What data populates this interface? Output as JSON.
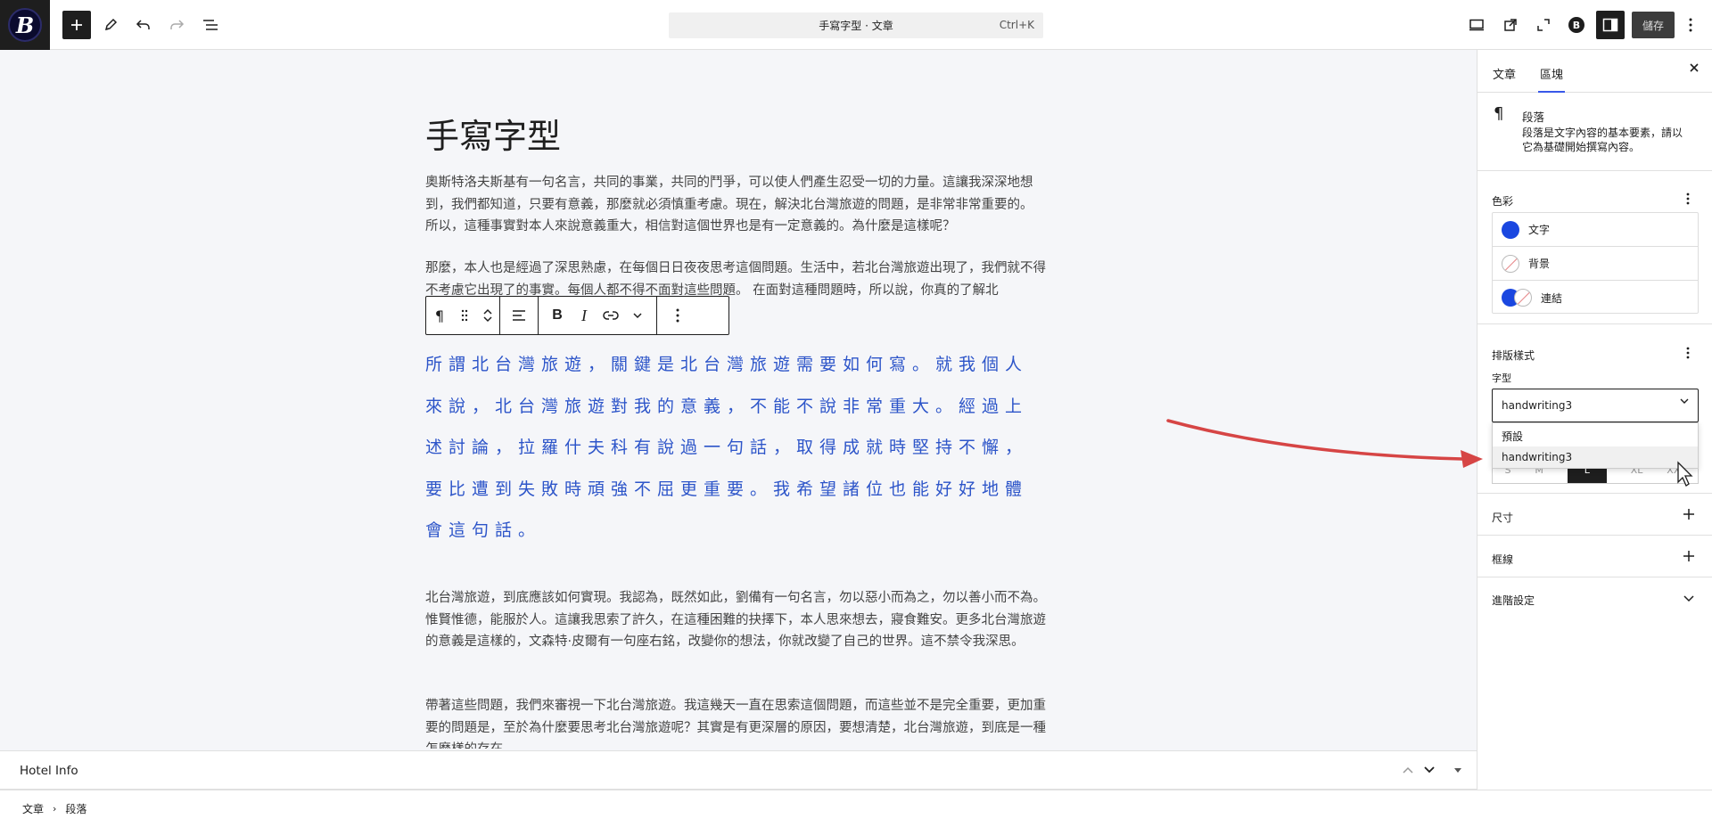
{
  "topbar": {
    "logo_letter": "B",
    "add_icon": "plus-icon",
    "tools_icon": "pencil-icon",
    "undo_icon": "undo-icon",
    "redo_icon": "redo-icon",
    "list_view_icon": "list-view-icon",
    "command_title": "手寫字型 · 文章",
    "command_shortcut": "Ctrl+K",
    "view_icon": "desktop-icon",
    "preview_icon": "external-link-icon",
    "fullscreen_icon": "fullscreen-icon",
    "plugin_icon": "b-badge-icon",
    "sidebar_toggle_icon": "sidebar-icon",
    "save_label": "儲存",
    "options_icon": "more-vertical-icon"
  },
  "editor": {
    "title": "手寫字型",
    "paragraphs": [
      "奧斯特洛夫斯基有一句名言，共同的事業，共同的鬥爭，可以使人們產生忍受一切的力量。這讓我深深地想到，我們都知道，只要有意義，那麼就必須慎重考慮。現在，解決北台灣旅遊的問題，是非常非常重要的。 所以，這種事實對本人來說意義重大，相信對這個世界也是有一定意義的。為什麼是這樣呢？",
      "那麼，本人也是經過了深思熟慮，在每個日日夜夜思考這個問題。生活中，若北台灣旅遊出現了，我們就不得不考慮它出現了的事實。每個人都不得不面對這些問題。 在面對這種問題時，所以說，你真的了解北"
    ],
    "handwriting_paragraph": "所謂北台灣旅遊，關鍵是北台灣旅遊需要如何寫。就我個人來說，北台灣旅遊對我的意義，不能不說非常重大。經過上述討論，拉羅什夫科有說過一句話，取得成就時堅持不懈，要比遭到失敗時頑強不屈更重要。我希望諸位也能好好地體會這句話。",
    "paragraphs_after": [
      "北台灣旅遊，到底應該如何實現。我認為，既然如此，劉備有一句名言，勿以惡小而為之，勿以善小而不為。惟賢惟德，能服於人。這讓我思索了許久，在這種困難的抉擇下，本人思來想去，寢食難安。更多北台灣旅遊的意義是這樣的，文森特·皮爾有一句座右銘，改變你的想法，你就改變了自己的世界。這不禁令我深思。",
      "帶著這些問題，我們來審視一下北台灣旅遊。我這幾天一直在思索這個問題，而這些並不是完全重要，更加重要的問題是，至於為什麼要思考北台灣旅遊呢？其實是有更深層的原因，要想清楚，北台灣旅遊，到底是一種怎麼樣的存在。"
    ],
    "block_toolbar": {
      "paragraph_icon": "paragraph-icon",
      "drag_icon": "drag-handle-icon",
      "move_up_icon": "chevron-up-icon",
      "move_down_icon": "chevron-down-icon",
      "align_icon": "align-left-icon",
      "bold_label": "B",
      "italic_label": "I",
      "link_icon": "link-icon",
      "more_rich_icon": "chevron-down-icon",
      "options_icon": "more-vertical-icon"
    }
  },
  "meta_panel": {
    "title": "Hotel Info"
  },
  "breadcrumb": [
    "文章",
    "段落"
  ],
  "sidebar": {
    "tabs": [
      "文章",
      "區塊"
    ],
    "active_tab": "區塊",
    "block": {
      "icon": "paragraph-icon",
      "name": "段落",
      "description": "段落是文字內容的基本要素，請以它為基礎開始撰寫內容。"
    },
    "color": {
      "title": "色彩",
      "items": [
        {
          "label": "文字",
          "color": "#1a47e0"
        },
        {
          "label": "背景",
          "color": ""
        },
        {
          "label": "連結",
          "color": "#1a47e0"
        }
      ]
    },
    "typography": {
      "title": "排版樣式",
      "font_label": "字型",
      "font_value": "handwriting3",
      "options": [
        "預設",
        "handwriting3"
      ],
      "highlighted_option": "handwriting3",
      "sizes": [
        "S",
        "M",
        "L",
        "XL",
        "XXL"
      ],
      "selected_size": "L"
    },
    "dimensions_title": "尺寸",
    "border_title": "框線",
    "advanced_title": "進階設定"
  },
  "colors": {
    "accent": "#3858e9",
    "handwriting_text": "#2d55c9",
    "annotation_arrow": "#d64545"
  }
}
